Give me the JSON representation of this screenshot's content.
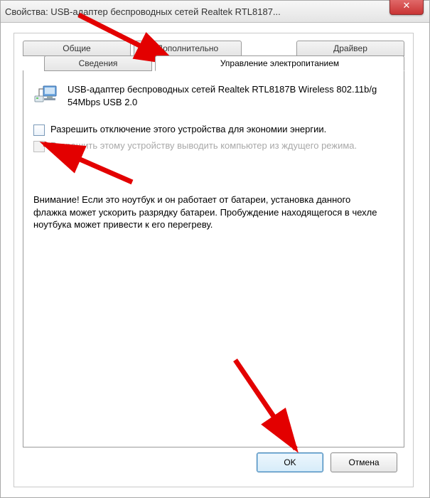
{
  "window": {
    "title": "Свойства: USB-адаптер беспроводных сетей Realtek RTL8187..."
  },
  "tabs": {
    "general": "Общие",
    "advanced": "Дополнительно",
    "driver": "Драйвер",
    "details": "Сведения",
    "power": "Управление электропитанием"
  },
  "device": {
    "name": "USB-адаптер беспроводных сетей Realtek RTL8187B Wireless 802.11b/g 54Mbps USB 2.0"
  },
  "checks": {
    "allow_off": "Разрешить отключение этого устройства для экономии энергии.",
    "allow_wake": "Разрешить этому устройству выводить компьютер из ждущего режима."
  },
  "note": "Внимание! Если это ноутбук и он работает от батареи, установка данного флажка может ускорить разрядку батареи. Пробуждение находящегося в чехле ноутбука может привести к его перегреву.",
  "buttons": {
    "ok": "OK",
    "cancel": "Отмена"
  }
}
